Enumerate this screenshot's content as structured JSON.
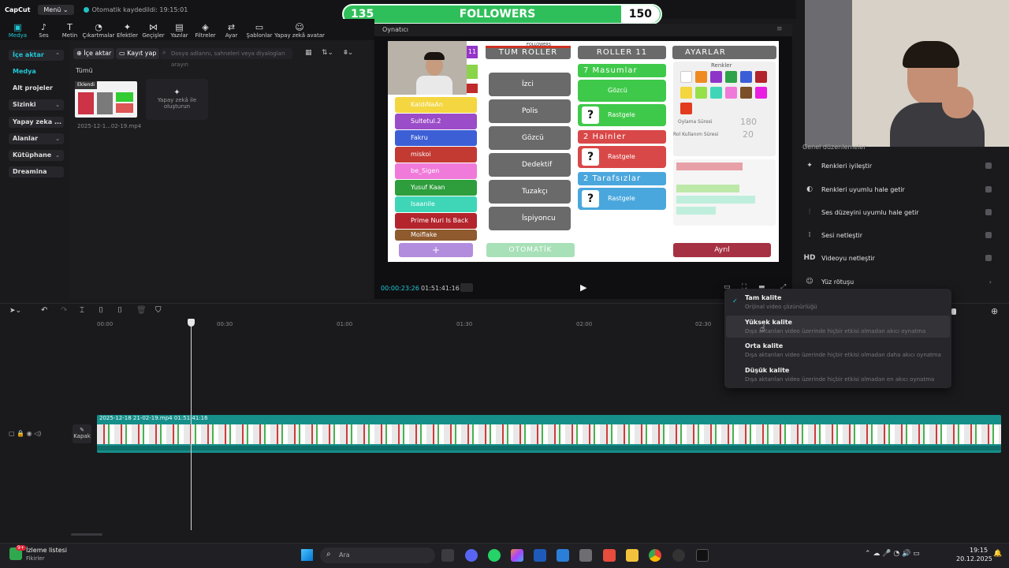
{
  "app": {
    "logo": "CapCut",
    "menu_label": "Menü",
    "autosave_text": "Otomatik kaydedildi: 19:15:01"
  },
  "followers": {
    "left": "135",
    "label": "FOLLOWERS",
    "right": "150"
  },
  "toolbar": {
    "items": [
      "Medya",
      "Ses",
      "Metin",
      "Çıkartmalar",
      "Efektler",
      "Geçişler",
      "Yazılar",
      "Filtreler",
      "Ayar",
      "Şablonlar",
      "Yapay zekâ avatar"
    ]
  },
  "leftnav": {
    "import": "İçe aktar",
    "media": "Medya",
    "subprojects": "Alt projeler",
    "yours": "Sizinki",
    "ai": "Yapay zeka ...",
    "spaces": "Alanlar",
    "library": "Kütüphane",
    "dreamina": "Dreamina"
  },
  "media": {
    "import_btn": "İçe aktar",
    "record_btn": "Kayıt yap",
    "search_placeholder": "Dosya adlarını, sahneleri veya diyalogları arayın",
    "all_label": "Tümü",
    "added_badge": "Eklendi",
    "file_name": "2025-12-1...02-19.mp4",
    "ai_card_line1": "Yapay zekâ ile",
    "ai_card_line2": "oluşturun"
  },
  "player": {
    "title": "Oynatıcı",
    "current_time": "00:00:23:26",
    "total_time": "01:51:41:16"
  },
  "game": {
    "header_all": "TÜM ROLLER",
    "header_all_count": "11",
    "header_roles": "ROLLER",
    "header_roles_count": "11",
    "header_settings": "AYARLAR",
    "followers_mini": "FOLLOWERS",
    "players": [
      "KaldıNaAn",
      "Sultetul.2",
      "Fakru",
      "miskoi",
      "be_Sigen",
      "Yusuf Kaan",
      "Isaanile",
      "Prime Nuri Is Back",
      "Moiflake"
    ],
    "all_roles": [
      "İzci",
      "Polis",
      "Gözcü",
      "Dedektif",
      "Tuzakçı",
      "İspiyoncu"
    ],
    "innocent_header": "7  Masumlar",
    "innocent_roles": [
      "Gözcü",
      "Rastgele"
    ],
    "traitor_header": "2  Hainler",
    "traitor_roles": [
      "Rastgele"
    ],
    "neutral_header": "2  Tarafsızlar",
    "neutral_roles": [
      "Rastgele"
    ],
    "colors_label": "Renkler",
    "vote_label": "Oylama Süresi",
    "vote_value": "180",
    "role_use_label": "Rol Kullanım Süresi",
    "role_use_value": "20",
    "add_btn": "+",
    "auto_btn": "OTOMATİK",
    "leave_btn": "Ayrıl"
  },
  "rightpanel": {
    "header": "Genel düzenlemeler",
    "items": [
      "Renkleri iyileştir",
      "Renkleri uyumlu hale getir",
      "Ses düzeyini uyumlu hale getir",
      "Sesi netleştir",
      "Videoyu netleştir",
      "Yüz rötuşu"
    ]
  },
  "quality_menu": [
    {
      "title": "Tam kalite",
      "desc": "Orijinal video çözünürlüğü",
      "selected": true
    },
    {
      "title": "Yüksek kalite",
      "desc": "Dışa aktarılan video üzerinde hiçbir etkisi olmadan akıcı oynatma",
      "selected": false
    },
    {
      "title": "Orta kalite",
      "desc": "Dışa aktarılan video üzerinde hiçbir etkisi olmadan daha akıcı oynatma",
      "selected": false
    },
    {
      "title": "Düşük kalite",
      "desc": "Dışa aktarılan video üzerinde hiçbir etkisi olmadan en akıcı oynatma",
      "selected": false
    }
  ],
  "timeline": {
    "ticks": [
      "00:00",
      "00:30",
      "01:00",
      "01:30",
      "02:00",
      "02:30"
    ],
    "clip_name": "2025-12-18 21-02-19.mp4",
    "clip_duration": "01:51:41:16",
    "cover_label": "Kapak"
  },
  "taskbar": {
    "watchlist_title": "İzleme listesi",
    "watchlist_sub": "Fikirler",
    "badge": "9+",
    "search_placeholder": "Ara",
    "time": "19:15",
    "date": "20.12.2025"
  },
  "colors": {
    "accent": "#21c7d6",
    "track": "#168f8a",
    "followers_green": "#2fbf5a"
  }
}
